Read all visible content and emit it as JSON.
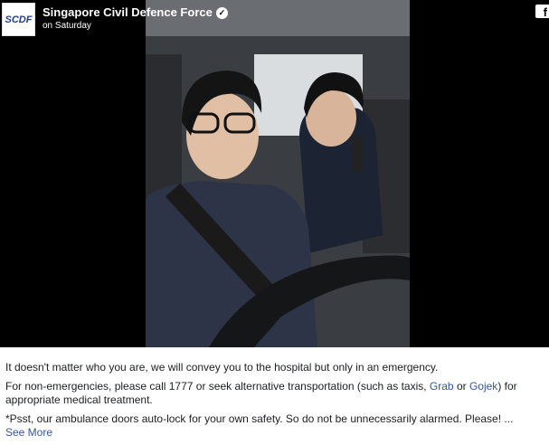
{
  "page": {
    "name": "Singapore Civil Defence Force",
    "time": "on Saturday",
    "avatar_text": "SCDF",
    "fb_glyph": "f"
  },
  "video": {
    "description_icon": "facebook-icon"
  },
  "caption": {
    "line1": "It doesn't matter who you are, we will convey you to the hospital but only in an emergency.",
    "line2_pre": "For non-emergencies, please call 1777 or seek alternative transportation (such as taxis, ",
    "link_grab": "Grab",
    "line2_mid": " or ",
    "link_gojek": "Gojek",
    "line2_post": ") for appropriate medical treatment.",
    "line3": "*Psst, our ambulance doors auto-lock for your own safety. So do not be unnecessarily alarmed. Please! ...",
    "see_more": "See More"
  },
  "colors": {
    "link": "#365899",
    "text": "#1c1e21",
    "video_bg": "#000000"
  }
}
